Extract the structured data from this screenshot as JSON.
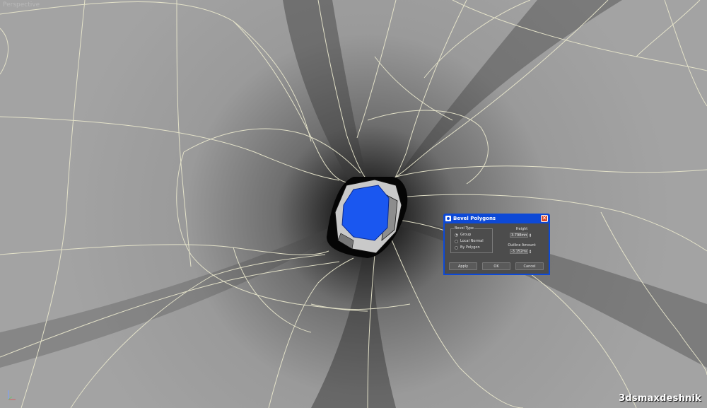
{
  "viewport": {
    "label": "Perspective",
    "selection_color": "#1a57f0",
    "wire_color": "#e8e6cc"
  },
  "dialog": {
    "title": "Bevel Polygons",
    "close_glyph": "✕",
    "bevel_type": {
      "label": "Bevel Type",
      "options": [
        "Group",
        "Local Normal",
        "By Polygon"
      ],
      "selected": "Group"
    },
    "height": {
      "label": "Height",
      "value": "3.798mm"
    },
    "outline": {
      "label": "Outline Amount",
      "value": "-3.152mm"
    },
    "buttons": {
      "apply": "Apply",
      "ok": "OK",
      "cancel": "Cancel"
    },
    "title_bar_color": "#0d49d6"
  },
  "watermark": "3dsmaxdeshnik",
  "icons": [
    "viewport-axis-icon",
    "dialog-app-icon",
    "close-icon",
    "spinner-arrows-icon"
  ]
}
